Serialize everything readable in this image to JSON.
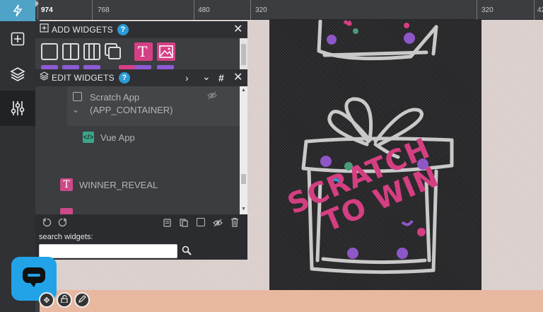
{
  "ruler": {
    "labels": [
      "974",
      "768",
      "480",
      "320",
      "320",
      "42"
    ]
  },
  "rail": {
    "icons": [
      "lightning-icon",
      "add-square-icon",
      "layers-icon",
      "sliders-icon"
    ]
  },
  "add_widgets": {
    "title": "ADD WIDGETS",
    "help": "?",
    "close": "✕"
  },
  "edit_widgets": {
    "title": "EDIT WIDGETS",
    "help": "?",
    "tree": [
      {
        "label": "Scratch App",
        "sublabel": "(APP_CONTAINER)"
      },
      {
        "label": "Vue App"
      },
      {
        "label": "WINNER_REVEAL"
      }
    ]
  },
  "search": {
    "label": "search widgets:",
    "value": "",
    "placeholder": ""
  },
  "canvas": {
    "banner_line1": "SCRATCH",
    "banner_line2": "TO WIN"
  },
  "colors": {
    "accent_blue": "#2b9bd7",
    "pink": "#d63f86",
    "purple": "#8d5bd6",
    "teal": "#3aa58a"
  }
}
